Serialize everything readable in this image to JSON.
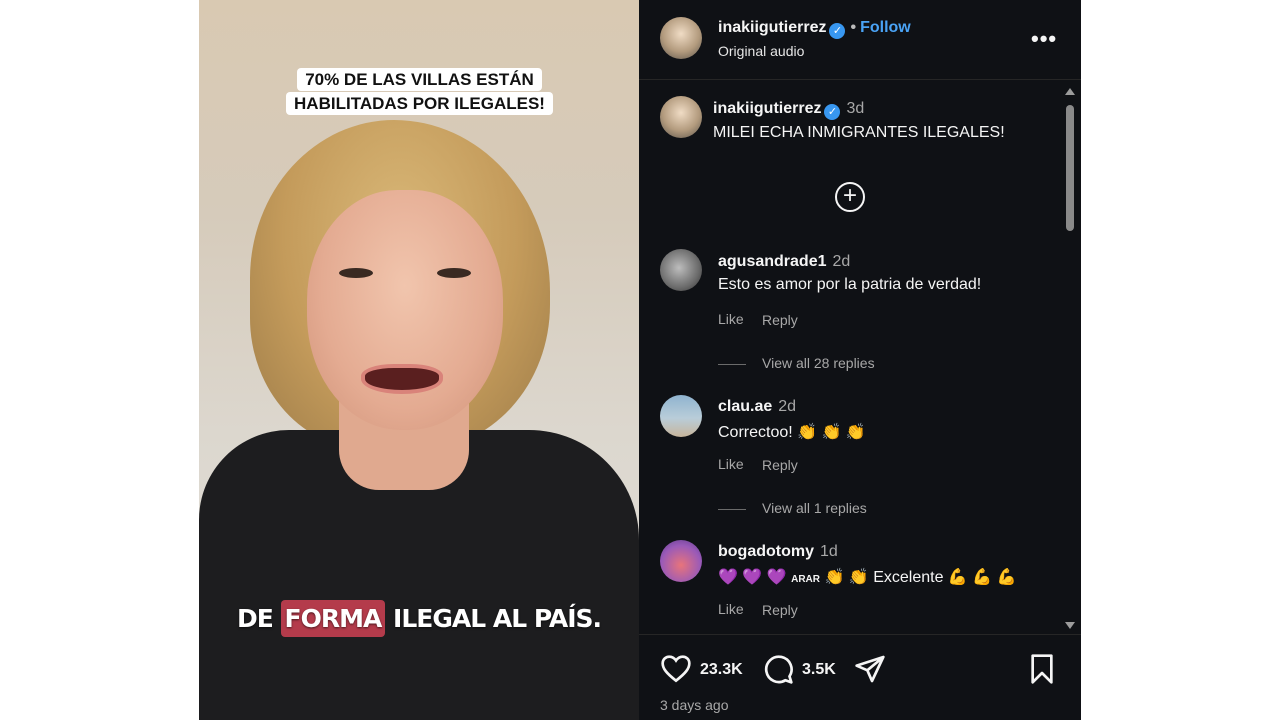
{
  "video": {
    "caption_top_line1": "70% DE LAS VILLAS ESTÁN",
    "caption_top_line2": "HABILITADAS POR ILEGALES!",
    "caption_bottom_pre": "DE",
    "caption_bottom_highlight": "FORMA",
    "caption_bottom_post": "ILEGAL AL PAÍS."
  },
  "header": {
    "username": "inakiigutierrez",
    "separator": "•",
    "follow_label": "Follow",
    "audio_label": "Original audio",
    "more_icon": "•••"
  },
  "post": {
    "username": "inakiigutierrez",
    "time": "3d",
    "caption": "MILEI ECHA INMIGRANTES ILEGALES!"
  },
  "comments": [
    {
      "username": "agusandrade1",
      "time": "2d",
      "text": "Esto es amor por la patria de verdad!",
      "like_label": "Like",
      "reply_label": "Reply",
      "view_replies": "View all 28 replies"
    },
    {
      "username": "clau.ae",
      "time": "2d",
      "text": "Correctoo!",
      "emoji": "👏 👏 👏",
      "like_label": "Like",
      "reply_label": "Reply",
      "view_replies": "View all 1 replies"
    },
    {
      "username": "bogadotomy",
      "time": "1d",
      "emoji_hearts": "💜 💜 💜",
      "small_text": "ARAR",
      "emoji_claps": "👏 👏",
      "text": "Excelente",
      "emoji_arms": "💪 💪 💪",
      "like_label": "Like",
      "reply_label": "Reply"
    }
  ],
  "footer": {
    "likes": "23.3K",
    "comments": "3.5K",
    "date": "3 days ago"
  },
  "icons": {
    "verified": "✓",
    "add": "+"
  }
}
